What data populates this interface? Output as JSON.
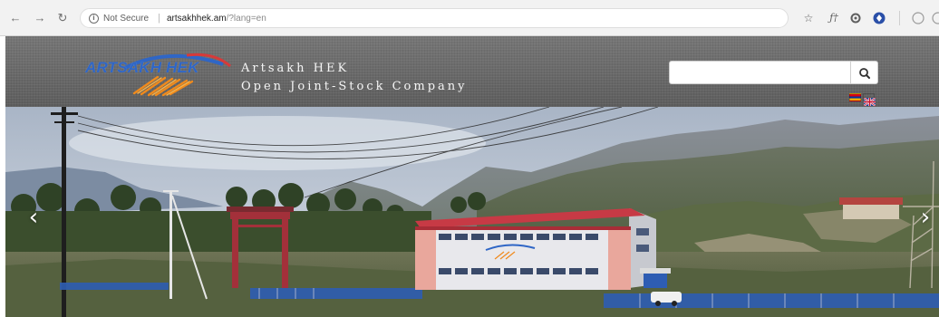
{
  "browser": {
    "security_label": "Not Secure",
    "url_host": "artsakhhek.am",
    "url_path": "/?lang=en"
  },
  "site": {
    "logo_text": "ARTSAKH HEK",
    "company_name_line1": "Artsakh HEK",
    "company_name_line2": "Open Joint-Stock Company"
  },
  "search": {
    "value": "",
    "placeholder": ""
  },
  "colors": {
    "logo_blue": "#2f66c6",
    "logo_orange": "#f08a1c",
    "building_roof": "#c73a45",
    "building_wall": "#e9a79c",
    "header_gray": "#6a6a6a"
  },
  "icons": {
    "back": "arrow-left-icon",
    "forward": "arrow-right-icon",
    "reload": "reload-icon",
    "info": "info-icon",
    "bookmark": "star-icon",
    "search": "magnifier-icon",
    "slider_prev": "chevron-left-icon",
    "slider_next": "chevron-right-icon"
  }
}
